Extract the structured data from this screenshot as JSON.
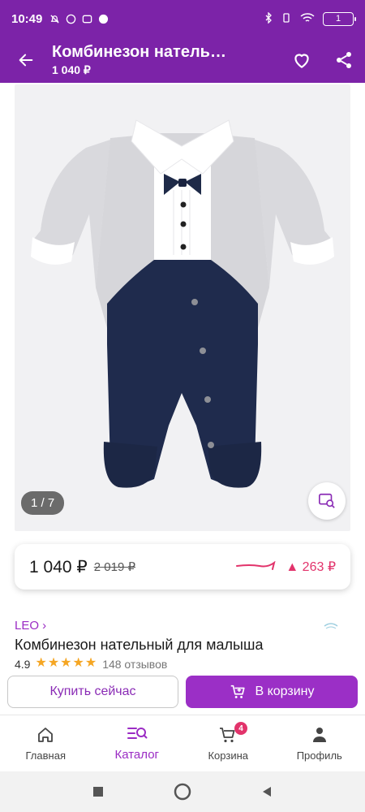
{
  "status_bar": {
    "time": "10:49",
    "battery": "1"
  },
  "app_bar": {
    "title": "Комбинезон натель…",
    "subtitle": "1 040 ₽"
  },
  "gallery": {
    "counter": "1 / 7"
  },
  "price": {
    "current": "1 040 ₽",
    "old": "2 019 ₽",
    "trend_delta": "▲ 263 ₽"
  },
  "product": {
    "brand": "LEO ›",
    "name": "Комбинезон нательный для малыша",
    "rating": "4.9",
    "stars": "★★★★★",
    "reviews": "148 отзывов"
  },
  "actions": {
    "buy_now": "Купить сейчас",
    "add_to_cart": "В корзину"
  },
  "nav": {
    "items": [
      {
        "label": "Главная",
        "icon": "home-icon"
      },
      {
        "label": "Каталог",
        "icon": "catalog-search-icon",
        "active": true
      },
      {
        "label": "Корзина",
        "icon": "cart-icon",
        "badge": "4"
      },
      {
        "label": "Профиль",
        "icon": "profile-icon"
      }
    ]
  },
  "colors": {
    "brand": "#7c23a8",
    "accent": "#9b2fc6",
    "price_up": "#e2336b"
  }
}
